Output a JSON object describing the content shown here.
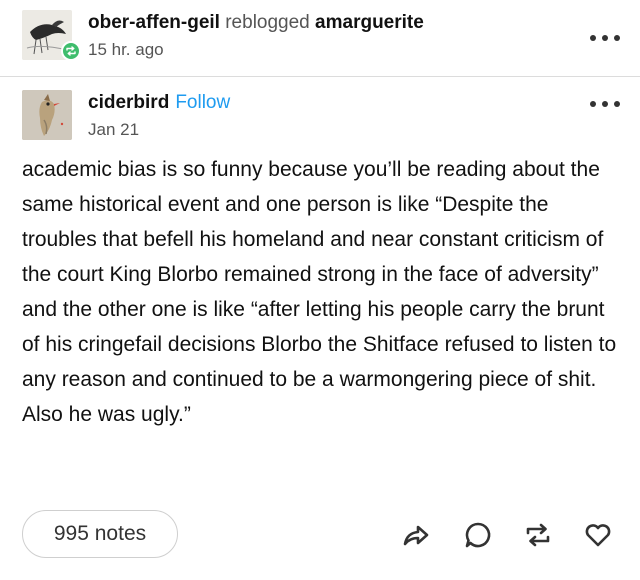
{
  "reblog": {
    "reblogger": "ober-affen-geil",
    "action": "reblogged",
    "source": "amarguerite",
    "time": "15 hr. ago"
  },
  "post": {
    "author": "ciderbird",
    "follow_label": "Follow",
    "date": "Jan 21",
    "body": "academic bias is so funny because you’ll be reading about the same historical event and one person is like “Despite the troubles that befell his homeland and near constant criticism of the court King Blorbo remained strong in the face of adversity” and the other one is like “after letting his people carry the brunt of his cringefail decisions Blorbo the Shitface refused to listen to any reason and continued to be a warmongering piece of shit. Also he was ugly.”"
  },
  "footer": {
    "notes": "995 notes"
  },
  "icons": {
    "reblog_badge": "reblog-icon",
    "more": "more-dots-icon",
    "share": "share-icon",
    "reply": "reply-icon",
    "reblog": "reblog-icon",
    "like": "heart-icon"
  },
  "colors": {
    "follow": "#1e9bf0",
    "reblog_badge": "#3fbd6d"
  }
}
